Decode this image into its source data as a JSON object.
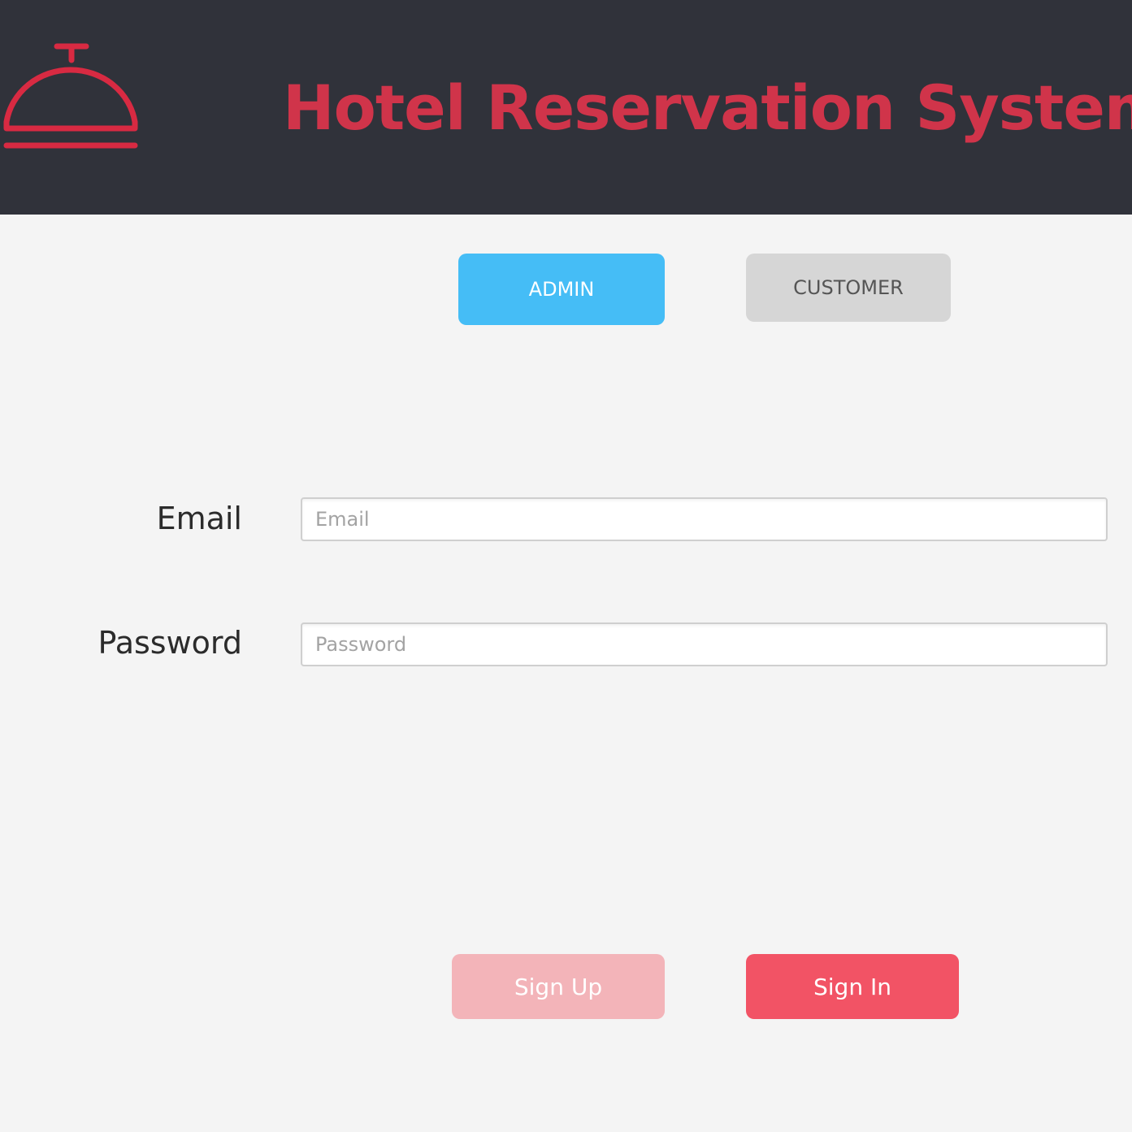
{
  "header": {
    "title": "Hotel Reservation System",
    "logo_icon": "service-bell-icon"
  },
  "role_tabs": {
    "admin_label": "ADMIN",
    "customer_label": "CUSTOMER",
    "selected": "ADMIN"
  },
  "form": {
    "email_label": "Email",
    "email_placeholder": "Email",
    "email_value": "",
    "password_label": "Password",
    "password_placeholder": "Password",
    "password_value": ""
  },
  "actions": {
    "sign_up_label": "Sign Up",
    "sign_in_label": "Sign In"
  },
  "colors": {
    "header_bg": "#30323a",
    "page_bg": "#f4f4f4",
    "title_color": "#d0344a",
    "bell_color": "#d82a42",
    "admin_active": "#45bdf6",
    "customer_inactive": "#d6d6d6",
    "sign_up": "#f3b4b9",
    "sign_in": "#f25365"
  }
}
